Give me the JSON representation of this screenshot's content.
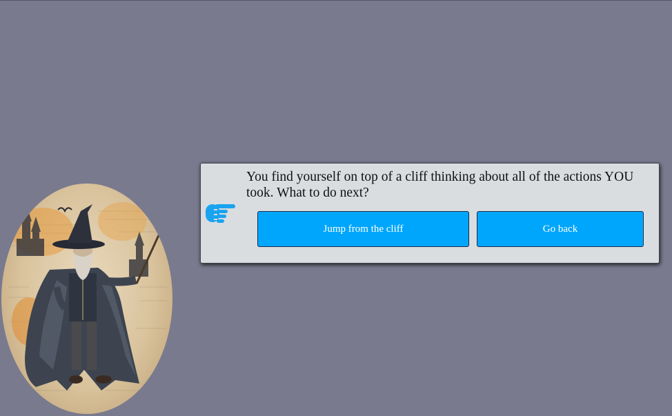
{
  "colors": {
    "background": "#797a8e",
    "dialog": "#d9dde0",
    "button": "#00a6fb",
    "icon": "#1aa3f0"
  },
  "portrait": {
    "icon": "wizard-portrait"
  },
  "dialog": {
    "icon": "pointing-hand-icon",
    "message": "You find yourself on top of a cliff thinking about all of the actions YOU took. What to do next?",
    "choices": [
      {
        "label": "Jump from the cliff"
      },
      {
        "label": "Go back"
      }
    ]
  }
}
